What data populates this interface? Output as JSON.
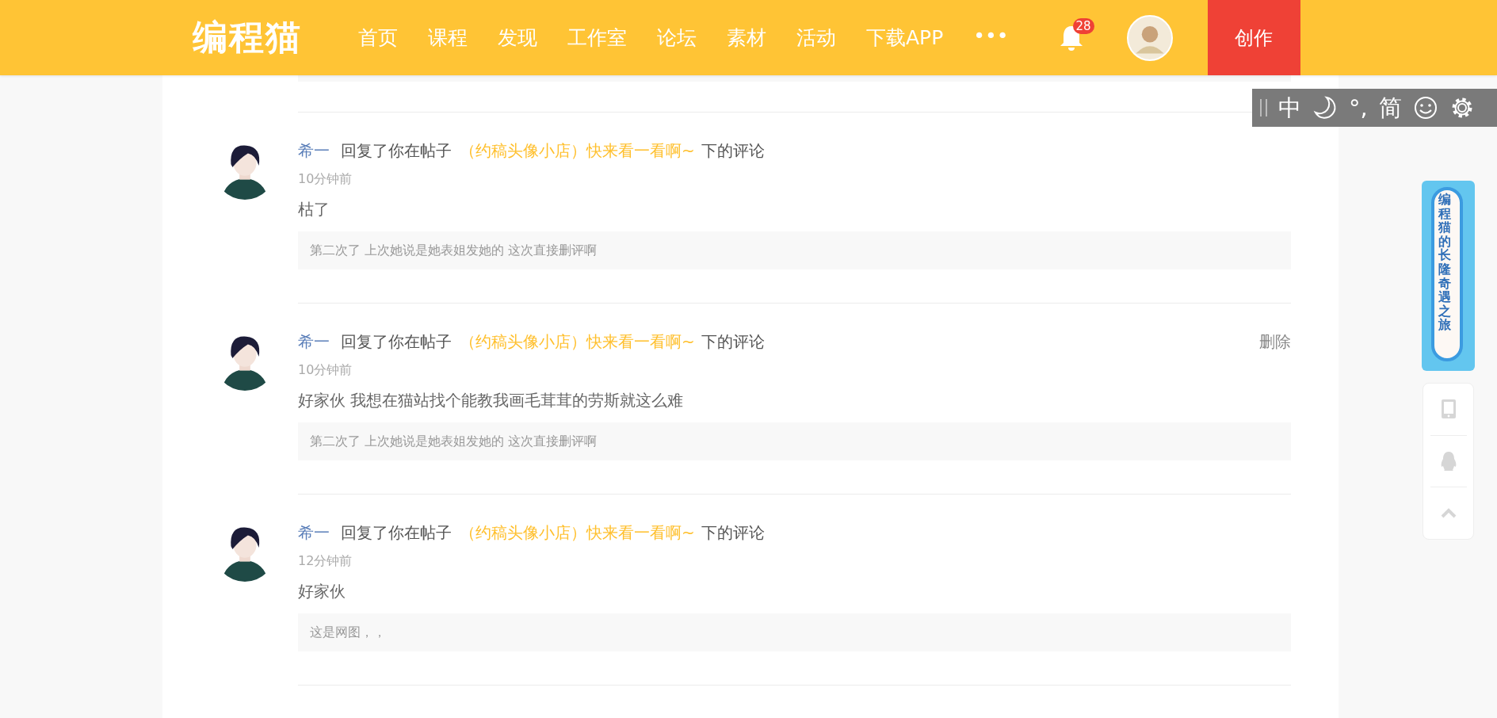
{
  "header": {
    "logo": "编程猫",
    "nav": [
      {
        "label": "首页"
      },
      {
        "label": "课程"
      },
      {
        "label": "发现"
      },
      {
        "label": "工作室"
      },
      {
        "label": "论坛"
      },
      {
        "label": "素材"
      },
      {
        "label": "活动"
      },
      {
        "label": "下载APP"
      },
      {
        "label": "•••"
      }
    ],
    "notification_count": "28",
    "create_button": "创作"
  },
  "toolbar": {
    "items": [
      {
        "kind": "text",
        "label": "中"
      },
      {
        "kind": "moon"
      },
      {
        "kind": "text",
        "label": "°,"
      },
      {
        "kind": "text",
        "label": "简"
      },
      {
        "kind": "smiley"
      },
      {
        "kind": "gear"
      }
    ]
  },
  "replies": [
    {
      "user": "希一",
      "action": "回复了你在帖子",
      "post": "（约稿头像小店）快来看一看啊~",
      "suffix": "下的评论",
      "time": "10分钟前",
      "comment": "枯了",
      "quote": "第二次了 上次她说是她表姐发她的 这次直接删评啊"
    },
    {
      "user": "希一",
      "action": "回复了你在帖子",
      "post": "（约稿头像小店）快来看一看啊~",
      "suffix": "下的评论",
      "time": "10分钟前",
      "comment": "好家伙 我想在猫站找个能教我画毛茸茸的劳斯就这么难",
      "quote": "第二次了 上次她说是她表姐发她的 这次直接删评啊",
      "delete": "删除"
    },
    {
      "user": "希一",
      "action": "回复了你在帖子",
      "post": "（约稿头像小店）快来看一看啊~",
      "suffix": "下的评论",
      "time": "12分钟前",
      "comment": "好家伙",
      "quote": "这是网图，，"
    }
  ],
  "banner": {
    "text": "编程猫的长隆奇遇之旅"
  },
  "side_tools": [
    {
      "kind": "tablet"
    },
    {
      "kind": "penguin"
    },
    {
      "kind": "top"
    }
  ]
}
